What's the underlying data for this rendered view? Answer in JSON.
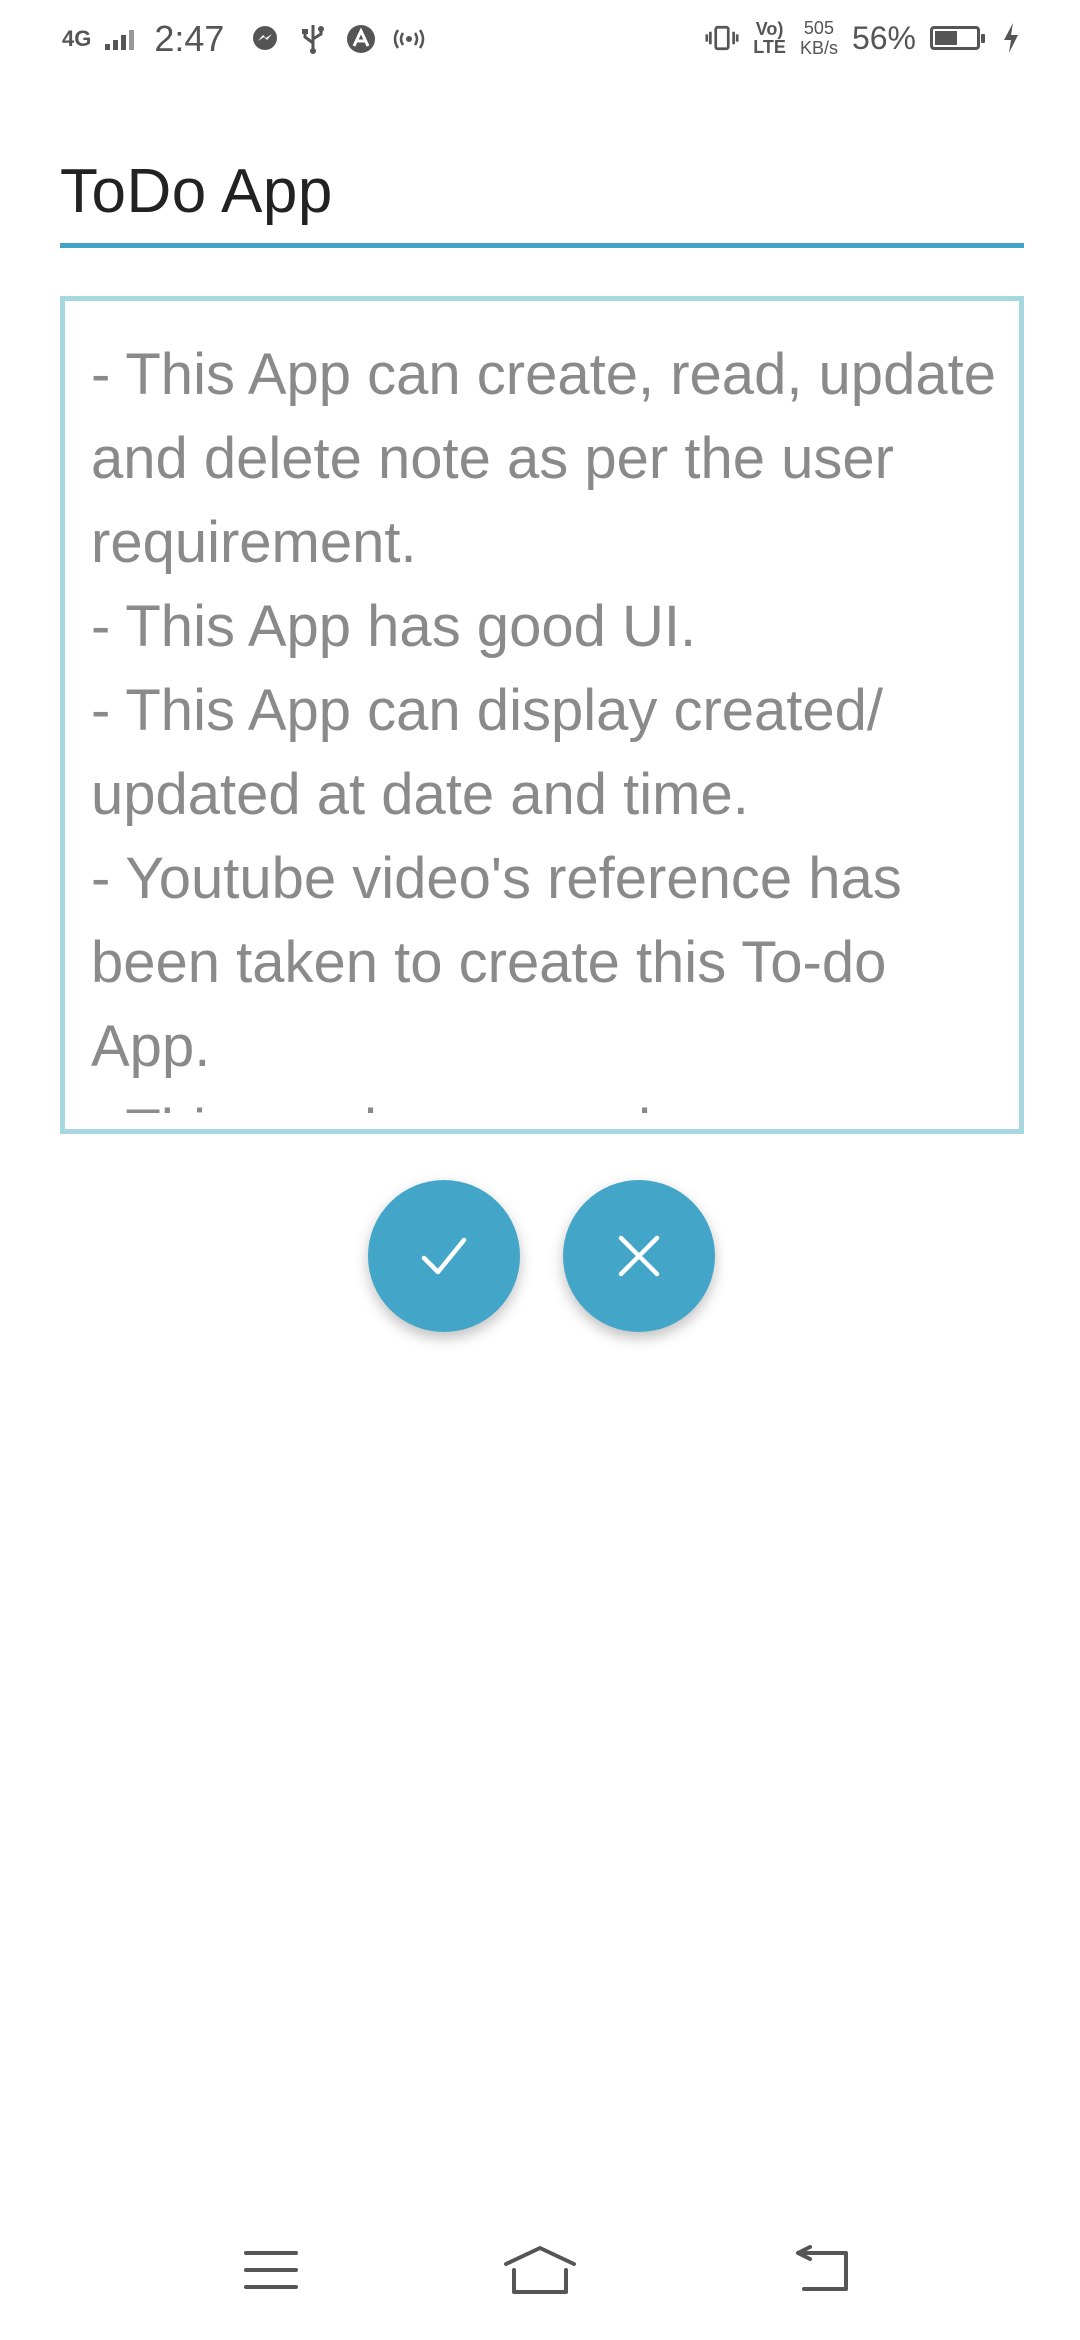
{
  "status_bar": {
    "network_type": "4G",
    "time": "2:47",
    "volte_line1": "Vo)",
    "volte_line2": "LTE",
    "speed_value": "505",
    "speed_unit": "KB/s",
    "battery_percent": "56%",
    "battery_level": 0.56,
    "icons": [
      "messenger-icon",
      "usb-icon",
      "app-icon",
      "hotspot-icon",
      "vibrate-icon",
      "charging-icon"
    ]
  },
  "note": {
    "title": "ToDo App",
    "body": "- This App can create, read, update and delete note as per the user requirement.\n- This App has good UI.\n- This App can display created/ updated at date and time.\n- Youtube video's reference has been taken to create this To-do App.\n- This app has a good"
  },
  "actions": {
    "save_icon": "check-icon",
    "cancel_icon": "close-icon"
  },
  "nav_bar": {
    "icons": [
      "menu-icon",
      "home-icon",
      "back-icon"
    ]
  },
  "colors": {
    "accent": "#43a6c8",
    "title_underline": "#3fa3c6",
    "body_border": "#a7d8e0",
    "body_text": "#8a8a8a"
  }
}
